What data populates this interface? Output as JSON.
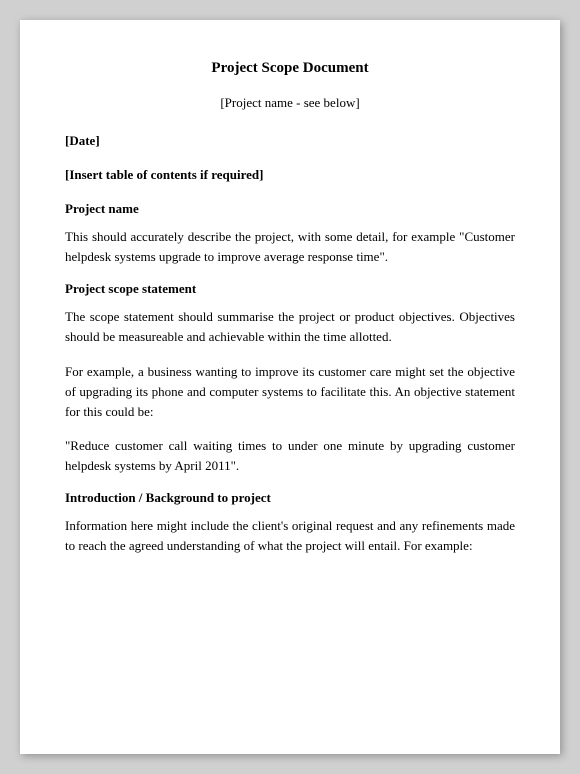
{
  "document": {
    "title": "Project Scope Document",
    "project_placeholder": "[Project name - see below]",
    "date_placeholder": "[Date]",
    "toc_placeholder": "[Insert table of contents if required]",
    "sections": [
      {
        "id": "project-name",
        "heading": "Project name",
        "paragraphs": [
          "This should accurately describe the project, with some detail, for example \"Customer helpdesk systems upgrade to improve average response time\"."
        ]
      },
      {
        "id": "project-scope-statement",
        "heading": "Project scope statement",
        "paragraphs": [
          "The scope statement should summarise the project or product objectives. Objectives should be measureable and achievable within the time allotted.",
          "For example, a business wanting to improve its customer care might set the objective of upgrading its phone and computer systems to facilitate this. An objective statement for this could be:",
          "\"Reduce customer call waiting times to under one minute by upgrading customer helpdesk systems by April 2011\"."
        ]
      },
      {
        "id": "introduction-background",
        "heading": "Introduction / Background to project",
        "paragraphs": [
          "Information here might include the client's original request and any refinements made to reach the agreed understanding of what the project will entail. For example:"
        ]
      }
    ]
  }
}
